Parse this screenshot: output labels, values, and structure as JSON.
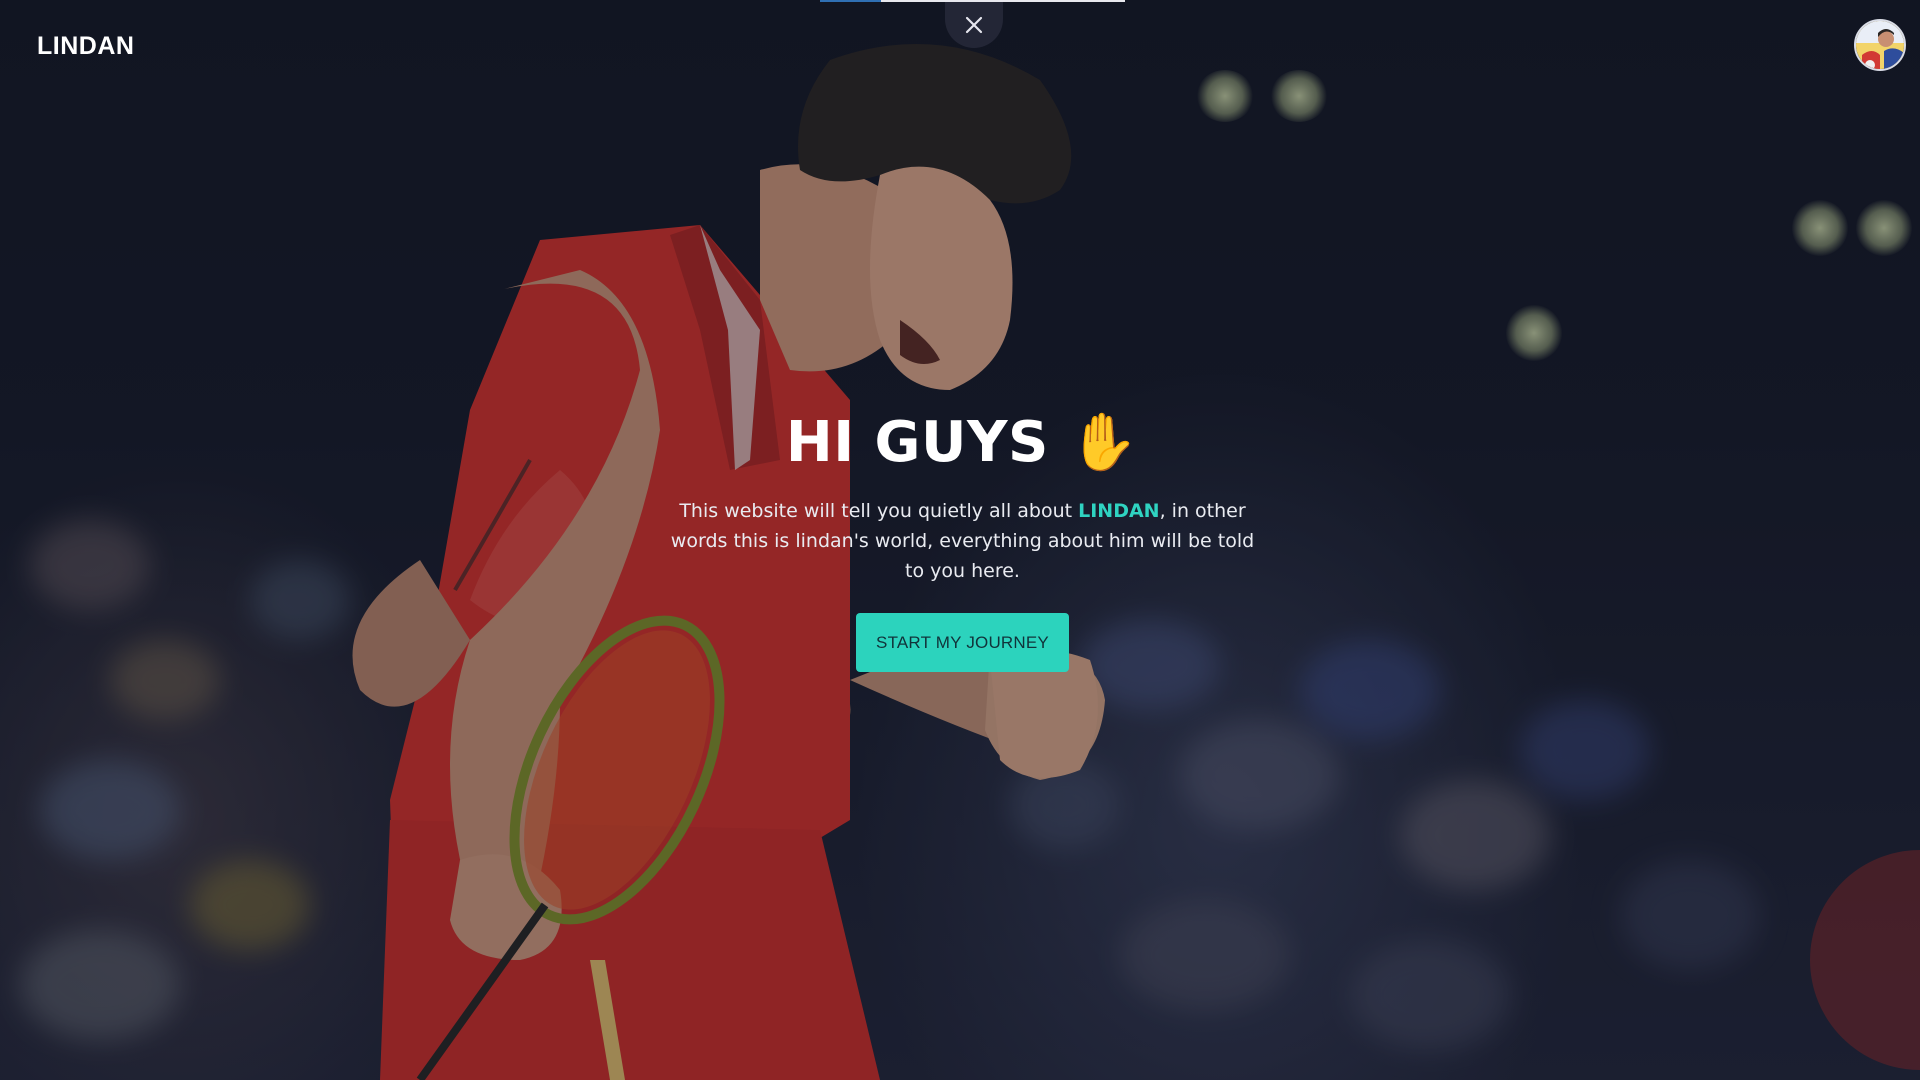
{
  "header": {
    "logo_text": "LINDAN"
  },
  "progress": {
    "value_fraction": 0.2,
    "fill_color": "#2f6fb3"
  },
  "close": {
    "icon": "close-icon"
  },
  "avatar": {
    "icon": "user-avatar"
  },
  "hero": {
    "heading": "HI GUYS",
    "heading_emoji": "✋",
    "intro_before": "This website will tell you quietly all about ",
    "intro_highlight": "LINDAN",
    "intro_after": ", in other words this is lindan's world, everything about him will be told to you here.",
    "cta_label": "START MY JOURNEY"
  },
  "colors": {
    "accent": "#2cd3bd",
    "highlight_text": "#2fd3c1",
    "background": "#141826"
  }
}
